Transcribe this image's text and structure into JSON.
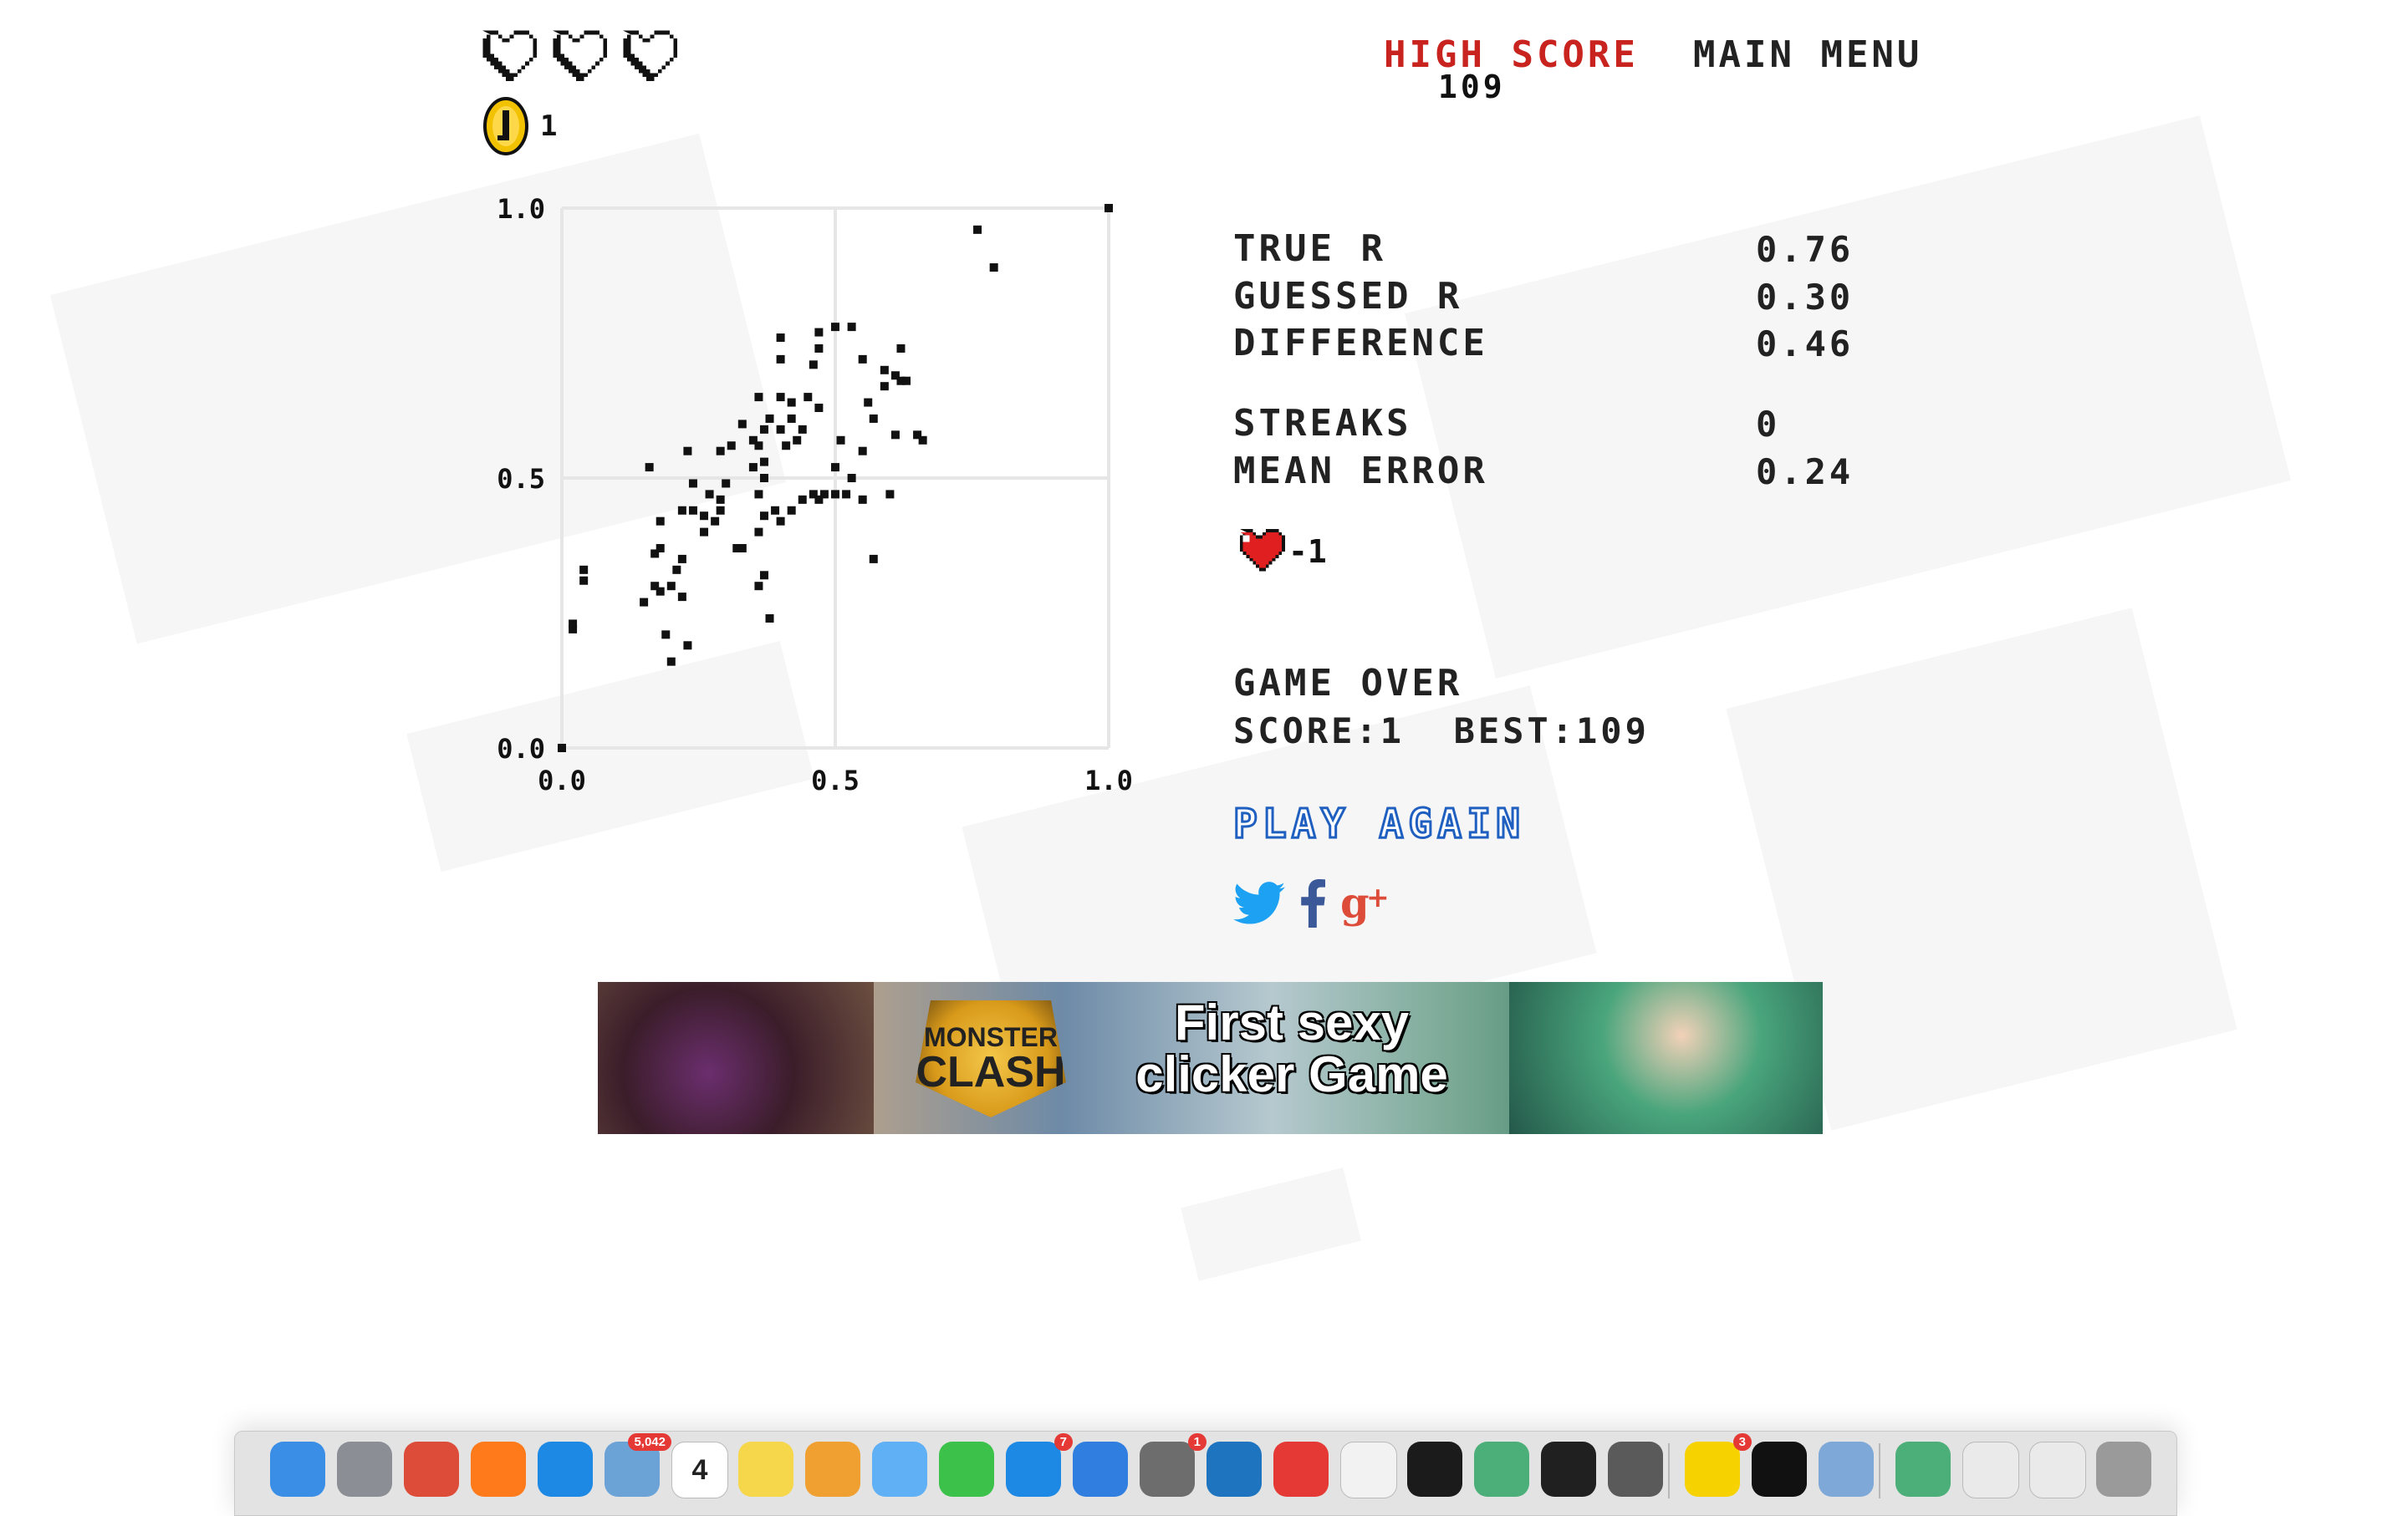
{
  "hud": {
    "lives_total": 3,
    "lives_filled": 0,
    "coins": "1"
  },
  "header": {
    "high_score_label": "HIGH SCORE",
    "high_score_value": "109",
    "main_menu_label": "MAIN MENU"
  },
  "stats": {
    "true_r_label": "TRUE R",
    "true_r_value": "0.76",
    "guessed_r_label": "GUESSED R",
    "guessed_r_value": "0.30",
    "difference_label": "DIFFERENCE",
    "difference_value": "0.46",
    "streaks_label": "STREAKS",
    "streaks_value": "0",
    "mean_error_label": "MEAN ERROR",
    "mean_error_value": "0.24",
    "life_change": "-1"
  },
  "result": {
    "game_over": "GAME OVER",
    "score_line": "SCORE:1  BEST:109",
    "play_again": "PLAY AGAIN"
  },
  "colors": {
    "accent_red": "#c8231e",
    "play_again_blue": "#1f5fc0",
    "twitter": "#1da1f2",
    "facebook": "#3b5998",
    "google_plus": "#dd4b39"
  },
  "social": [
    "twitter-icon",
    "facebook-icon",
    "google-plus-icon"
  ],
  "ad": {
    "logo_line1": "MONSTER",
    "logo_line2": "CLASH",
    "headline_line1": "First sexy",
    "headline_line2": "clicker Game"
  },
  "dock": {
    "items": [
      {
        "name": "finder",
        "color": "#3a8ee6"
      },
      {
        "name": "launchpad",
        "color": "#8b8f95"
      },
      {
        "name": "chrome",
        "color": "#dd4b39"
      },
      {
        "name": "firefox",
        "color": "#ff7a1a"
      },
      {
        "name": "safari",
        "color": "#1e88e5"
      },
      {
        "name": "mail",
        "color": "#6ba3d6",
        "badge": "5,042"
      },
      {
        "name": "calendar",
        "color": "#ffffff",
        "text": "4"
      },
      {
        "name": "notes",
        "color": "#f6d64a"
      },
      {
        "name": "photos",
        "color": "#f0a030"
      },
      {
        "name": "messages",
        "color": "#5fb0f5"
      },
      {
        "name": "facetime",
        "color": "#3cc24a"
      },
      {
        "name": "app-store",
        "color": "#1e88e5",
        "badge": "7"
      },
      {
        "name": "bluetooth",
        "color": "#2f7ee0"
      },
      {
        "name": "system-preferences",
        "color": "#6d6d6d",
        "badge": "1"
      },
      {
        "name": "vscode",
        "color": "#1f74c0"
      },
      {
        "name": "news",
        "color": "#e53935"
      },
      {
        "name": "textedit",
        "color": "#f2f2f2"
      },
      {
        "name": "terminal",
        "color": "#1b1b1b"
      },
      {
        "name": "atom",
        "color": "#4caf7a"
      },
      {
        "name": "activity-monitor",
        "color": "#202020"
      },
      {
        "name": "sequel-pro",
        "color": "#5a5a5a"
      },
      {
        "name": "kakaotalk",
        "color": "#f6d200",
        "badge": "3"
      },
      {
        "name": "pycharm",
        "color": "#111111"
      },
      {
        "name": "preview",
        "color": "#7da8d8"
      },
      {
        "name": "atom-2",
        "color": "#4caf7a"
      },
      {
        "name": "window-1",
        "color": "#eaeaea"
      },
      {
        "name": "window-2",
        "color": "#eaeaea"
      },
      {
        "name": "trash",
        "color": "#9a9a9a"
      }
    ]
  },
  "chart_data": {
    "type": "scatter",
    "x_ticks": [
      "0.0",
      "0.5",
      "1.0"
    ],
    "y_ticks": [
      "0.0",
      "0.5",
      "1.0"
    ],
    "xlim": [
      0,
      1
    ],
    "ylim": [
      0,
      1
    ],
    "grid": true,
    "points": [
      [
        0.0,
        0.0
      ],
      [
        1.0,
        1.0
      ],
      [
        0.76,
        0.96
      ],
      [
        0.79,
        0.89
      ],
      [
        0.02,
        0.22
      ],
      [
        0.02,
        0.23
      ],
      [
        0.04,
        0.31
      ],
      [
        0.04,
        0.33
      ],
      [
        0.15,
        0.27
      ],
      [
        0.17,
        0.3
      ],
      [
        0.18,
        0.29
      ],
      [
        0.2,
        0.3
      ],
      [
        0.19,
        0.21
      ],
      [
        0.2,
        0.16
      ],
      [
        0.23,
        0.19
      ],
      [
        0.22,
        0.28
      ],
      [
        0.17,
        0.36
      ],
      [
        0.18,
        0.37
      ],
      [
        0.21,
        0.33
      ],
      [
        0.22,
        0.35
      ],
      [
        0.18,
        0.42
      ],
      [
        0.22,
        0.44
      ],
      [
        0.24,
        0.44
      ],
      [
        0.26,
        0.43
      ],
      [
        0.26,
        0.4
      ],
      [
        0.28,
        0.42
      ],
      [
        0.29,
        0.44
      ],
      [
        0.27,
        0.47
      ],
      [
        0.24,
        0.49
      ],
      [
        0.16,
        0.52
      ],
      [
        0.23,
        0.55
      ],
      [
        0.29,
        0.55
      ],
      [
        0.29,
        0.46
      ],
      [
        0.31,
        0.56
      ],
      [
        0.33,
        0.6
      ],
      [
        0.35,
        0.57
      ],
      [
        0.35,
        0.52
      ],
      [
        0.36,
        0.47
      ],
      [
        0.37,
        0.5
      ],
      [
        0.37,
        0.53
      ],
      [
        0.36,
        0.56
      ],
      [
        0.37,
        0.59
      ],
      [
        0.38,
        0.61
      ],
      [
        0.4,
        0.59
      ],
      [
        0.41,
        0.56
      ],
      [
        0.42,
        0.61
      ],
      [
        0.43,
        0.57
      ],
      [
        0.44,
        0.59
      ],
      [
        0.42,
        0.64
      ],
      [
        0.4,
        0.65
      ],
      [
        0.36,
        0.65
      ],
      [
        0.37,
        0.43
      ],
      [
        0.4,
        0.42
      ],
      [
        0.42,
        0.44
      ],
      [
        0.44,
        0.46
      ],
      [
        0.46,
        0.47
      ],
      [
        0.47,
        0.46
      ],
      [
        0.48,
        0.47
      ],
      [
        0.5,
        0.47
      ],
      [
        0.52,
        0.47
      ],
      [
        0.55,
        0.46
      ],
      [
        0.53,
        0.5
      ],
      [
        0.55,
        0.55
      ],
      [
        0.57,
        0.61
      ],
      [
        0.59,
        0.67
      ],
      [
        0.61,
        0.69
      ],
      [
        0.62,
        0.68
      ],
      [
        0.63,
        0.68
      ],
      [
        0.65,
        0.58
      ],
      [
        0.66,
        0.57
      ],
      [
        0.61,
        0.58
      ],
      [
        0.62,
        0.74
      ],
      [
        0.55,
        0.72
      ],
      [
        0.53,
        0.78
      ],
      [
        0.5,
        0.78
      ],
      [
        0.47,
        0.77
      ],
      [
        0.47,
        0.74
      ],
      [
        0.46,
        0.71
      ],
      [
        0.4,
        0.76
      ],
      [
        0.4,
        0.72
      ],
      [
        0.45,
        0.65
      ],
      [
        0.47,
        0.63
      ],
      [
        0.51,
        0.57
      ],
      [
        0.5,
        0.52
      ],
      [
        0.56,
        0.64
      ],
      [
        0.59,
        0.7
      ],
      [
        0.6,
        0.47
      ],
      [
        0.57,
        0.35
      ],
      [
        0.33,
        0.37
      ],
      [
        0.36,
        0.3
      ],
      [
        0.37,
        0.32
      ],
      [
        0.38,
        0.24
      ],
      [
        0.32,
        0.37
      ],
      [
        0.3,
        0.49
      ],
      [
        0.36,
        0.4
      ],
      [
        0.39,
        0.44
      ]
    ]
  }
}
